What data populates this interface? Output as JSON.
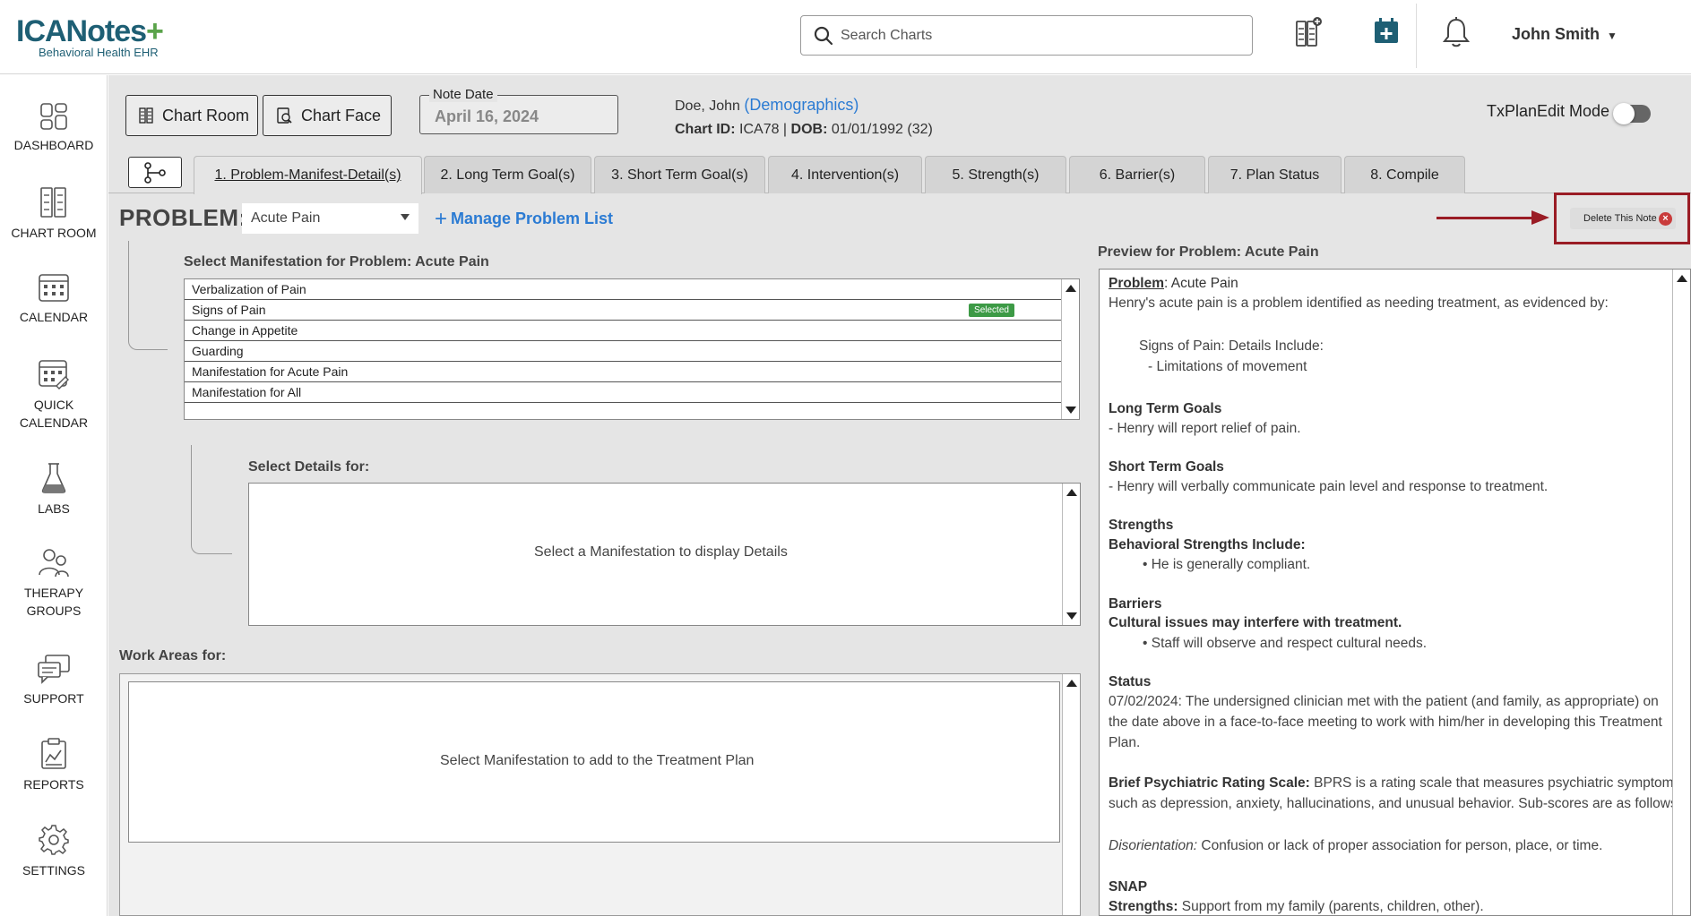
{
  "header": {
    "logo_main": "ICANotes",
    "logo_plus": "+",
    "logo_sub": "Behavioral Health EHR",
    "search_placeholder": "Search Charts",
    "user_name": "John Smith",
    "icons": [
      "add-chart-icon",
      "calendar-add-icon",
      "bell-icon"
    ]
  },
  "sidebar": {
    "items": [
      {
        "label": "DASHBOARD",
        "icon": "dashboard-icon"
      },
      {
        "label": "CHART ROOM",
        "icon": "chart-room-icon"
      },
      {
        "label": "CALENDAR",
        "icon": "calendar-icon"
      },
      {
        "label": "QUICK\nCALENDAR",
        "label1": "QUICK",
        "label2": "CALENDAR",
        "icon": "quick-calendar-icon"
      },
      {
        "label": "LABS",
        "icon": "flask-icon"
      },
      {
        "label1": "THERAPY",
        "label2": "GROUPS",
        "icon": "groups-icon"
      },
      {
        "label": "SUPPORT",
        "icon": "support-icon"
      },
      {
        "label": "REPORTS",
        "icon": "reports-icon"
      },
      {
        "label": "SETTINGS",
        "icon": "settings-icon"
      }
    ]
  },
  "toolbar": {
    "chart_room": "Chart Room",
    "chart_face": "Chart Face",
    "note_date_label": "Note Date",
    "note_date_value": "April 16, 2024"
  },
  "patient": {
    "name": "Doe, John",
    "demographics_link": "(Demographics)",
    "chart_id_label": "Chart ID:",
    "chart_id": "ICA78",
    "dob_label": "DOB:",
    "dob": "01/01/1992 (32)"
  },
  "tx_mode_label": "TxPlanEdit Mode",
  "tabs": [
    "1. Problem-Manifest-Detail(s)",
    "2. Long Term Goal(s)",
    "3. Short Term Goal(s)",
    "4. Intervention(s)",
    "5. Strength(s)",
    "6. Barrier(s)",
    "7. Plan Status",
    "8. Compile"
  ],
  "problem": {
    "label": "PROBLEM:",
    "selected": "Acute Pain",
    "manage_plus": "+",
    "manage_label": "Manage Problem List",
    "delete_label": "Delete This Note",
    "delete_x": "×"
  },
  "manifestation": {
    "title": "Select Manifestation for Problem: Acute Pain",
    "items": [
      "Verbalization of Pain",
      "Signs of Pain",
      "Change in Appetite",
      "Guarding",
      "Manifestation for Acute Pain",
      "Manifestation for All"
    ],
    "selected_badge": "Selected"
  },
  "details": {
    "title": "Select Details for:",
    "placeholder": "Select a Manifestation to display Details"
  },
  "work_areas": {
    "title": "Work Areas for:",
    "placeholder": "Select Manifestation to add to the Treatment Plan"
  },
  "preview": {
    "title": "Preview for Problem: Acute Pain",
    "problem_label": "Problem",
    "problem_value": ": Acute Pain",
    "intro": "Henry's acute pain is a problem identified as needing treatment, as evidenced by:",
    "sign_header": "Signs of Pain: Details Include:",
    "sign_detail": "- Limitations of movement",
    "ltg_header": "Long Term Goals",
    "ltg_item": "-  Henry will report relief of pain.",
    "stg_header": "Short Term Goals",
    "stg_item": "-  Henry will verbally communicate pain level and response to treatment.",
    "strengths_header": "Strengths",
    "strengths_sub": "Behavioral Strengths Include:",
    "strengths_item": "He is generally compliant.",
    "barriers_header": "Barriers",
    "barriers_sub": "Cultural issues may interfere with treatment.",
    "barriers_item": "Staff will observe and respect cultural needs.",
    "status_header": "Status",
    "status_line1": "07/02/2024: The undersigned clinician met with the patient (and family, as appropriate) on",
    "status_line2": "the date above in a face-to-face meeting to work with him/her in developing this Treatment",
    "status_line3": "Plan.",
    "bprs_label": "Brief Psychiatric Rating Scale:",
    "bprs_line1": " BPRS is a rating scale that measures psychiatric symptoms",
    "bprs_line2": "such as depression, anxiety, hallucinations, and unusual behavior. Sub-scores are as follows:",
    "disorientation_label": "Disorientation:",
    "disorientation_text": " Confusion or lack of proper association for person, place, or time.",
    "snap_header": "SNAP",
    "snap_strengths_label": "Strengths:",
    "snap_strengths_text": " Support from my family (parents, children, other)."
  },
  "colors": {
    "accent_blue": "#2b7bd3",
    "brand_teal": "#1e5f74",
    "brand_green": "#5aa34a",
    "selected_green": "#3d9a46",
    "highlight_red": "#9a1c25",
    "delete_red": "#c93c3c"
  }
}
